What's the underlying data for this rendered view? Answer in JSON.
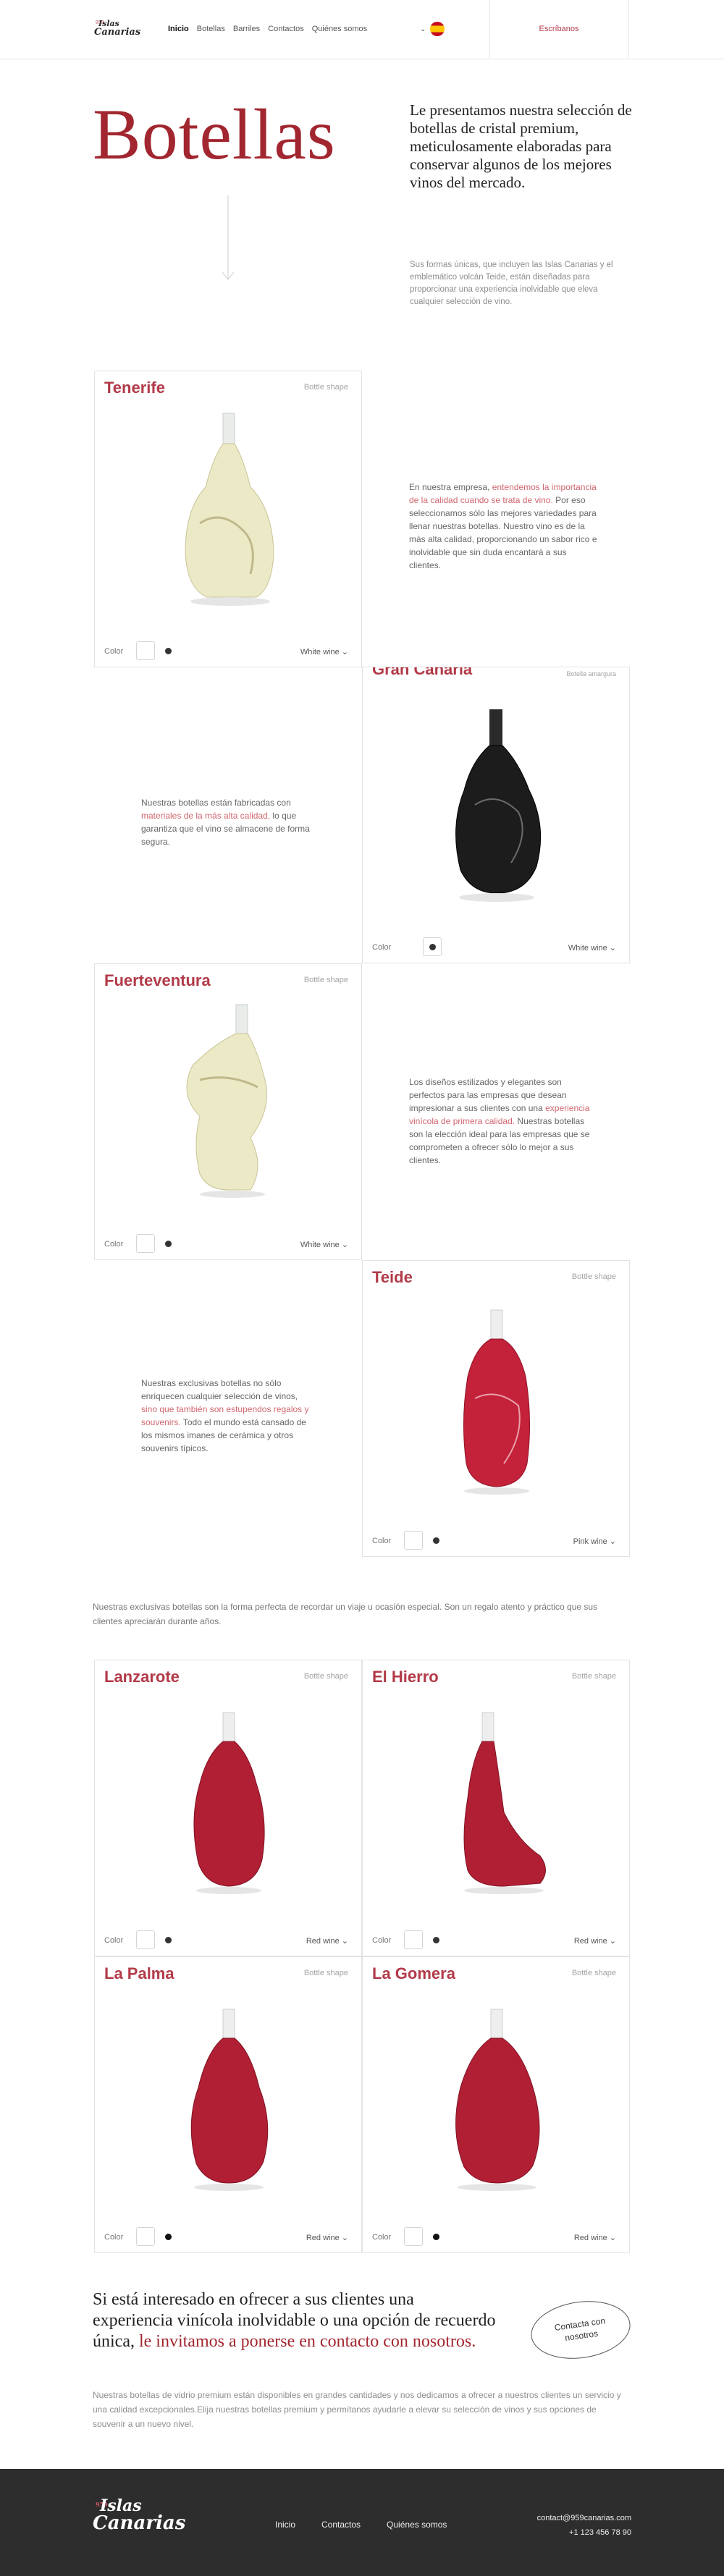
{
  "header": {
    "logo": {
      "line1": "Islas",
      "line2": "Canarias",
      "mark": "959"
    },
    "nav": [
      "Inicio",
      "Botellas",
      "Barriles",
      "Contactos",
      "Quiénes somos"
    ],
    "lang_icon": "chevron-down-icon",
    "contact_link": "Escríbanos"
  },
  "hero": {
    "title": "Botellas",
    "lead": "Le presentamos nuestra selección de botellas de cristal premium, meticulosamente elaboradas para conservar algunos de los mejores vinos del mercado.",
    "sub": "Sus formas únicas, que incluyen las Islas Canarias y el emblemático volcán Teide, están diseñadas para proporcionar una experiencia inolvidable que eleva cualquier selección de vino."
  },
  "labels": {
    "bottle_shape": "Bottle shape",
    "color": "Color"
  },
  "cards": [
    {
      "name": "Tenerife",
      "wine": "White wine"
    },
    {
      "name": "Gran Canaria",
      "wine": "White wine",
      "shape_text": "Botella amargura"
    },
    {
      "name": "Fuerteventura",
      "wine": "White wine"
    },
    {
      "name": "Teide",
      "wine": "Pink wine"
    },
    {
      "name": "Lanzarote",
      "wine": "Red wine"
    },
    {
      "name": "El Hierro",
      "wine": "Red wine"
    },
    {
      "name": "La Palma",
      "wine": "Red wine"
    },
    {
      "name": "La Gomera",
      "wine": "Red wine"
    }
  ],
  "descriptions": {
    "d1": {
      "a": "En nuestra empresa, ",
      "hl": "entendemos la importancia de la calidad cuando se trata de vino.",
      "b": " Por eso seleccionamos sólo las mejores variedades para llenar nuestras botellas. Nuestro vino es de la más alta calidad, proporcionando un sabor rico e inolvidable que sin duda encantará a sus clientes."
    },
    "d2": {
      "a": "Nuestras botellas están fabricadas con ",
      "hl": "materiales de la más alta calidad,",
      "b": " lo que garantiza que el vino se almacene de forma segura."
    },
    "d3": {
      "a": "Los diseños estilizados y elegantes son perfectos para las empresas que desean impresionar a sus clientes con una ",
      "hl": "experiencia vinícola de primera calidad.",
      "b": " Nuestras botellas son la elección ideal para las empresas que se comprometen a ofrecer sólo lo mejor a sus clientes."
    },
    "d4": {
      "a": "Nuestras exclusivas botellas no sólo enriquecen cualquier selección de vinos, ",
      "hl": "sino que también son estupendos regalos y souvenirs.",
      "b": " Todo el mundo está cansado de los mismos imanes de cerámica y otros souvenirs típicos."
    }
  },
  "strip": "Nuestras exclusivas botellas son la forma perfecta de recordar un viaje u ocasión especial. Son un regalo atento y práctico que sus clientes apreciarán durante años.",
  "cta": {
    "text_a": "Si está interesado en ofrecer a sus clientes una experiencia vinícola inolvidable o una opción de recuerdo única, ",
    "text_hl": "le invitamos a ponerse en contacto con nosotros.",
    "button": "Contacta con nosotros",
    "sub": "Nuestras botellas de vidrio premium están disponibles en grandes cantidades y nos dedicamos a ofrecer a nuestros clientes un servicio y una calidad excepcionales.Elija nuestras botellas premium y permítanos ayudarle a elevar su selección de vinos y sus opciones de souvenir a un nuevo nivel."
  },
  "footer": {
    "logo": {
      "line1": "Islas",
      "line2": "Canarias",
      "mark": "959"
    },
    "nav": [
      "Inicio",
      "Contactos",
      "Quiénes somos"
    ],
    "email": "contact@959canarias.com",
    "phone": "+1 123 456 78 90"
  },
  "colors": {
    "accent": "#a2262f",
    "accent_light": "#d0666f",
    "footer_bg": "#2d2d2d"
  }
}
